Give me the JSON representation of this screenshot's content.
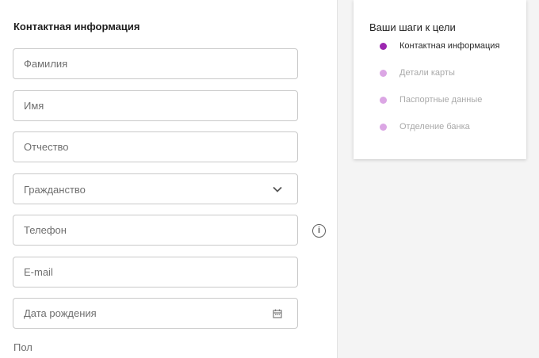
{
  "form": {
    "section_title": "Контактная информация",
    "fields": {
      "last_name": "Фамилия",
      "first_name": "Имя",
      "middle_name": "Отчество",
      "citizenship": "Гражданство",
      "phone": "Телефон",
      "email": "E-mail",
      "birth_date": "Дата рождения"
    },
    "gender_label": "Пол",
    "info_glyph": "i"
  },
  "steps": {
    "title": "Ваши шаги к цели",
    "items": [
      {
        "label": "Контактная информация",
        "state": "active"
      },
      {
        "label": "Детали карты",
        "state": "pending"
      },
      {
        "label": "Паспортные данные",
        "state": "pending"
      },
      {
        "label": "Отделение банка",
        "state": "pending"
      }
    ]
  },
  "colors": {
    "accent": "#9c27b0",
    "accent_light": "#dba6e4",
    "border": "#c9c9c9"
  },
  "icons": {
    "citizenship_trailing": "chevron-down-icon",
    "phone_info": "info-icon",
    "birth_date_trailing": "calendar-icon"
  }
}
